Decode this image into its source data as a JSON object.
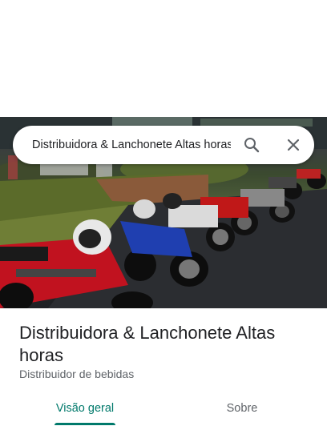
{
  "search": {
    "query": "Distribuidora & Lanchonete Altas horas"
  },
  "place": {
    "name": "Distribuidora & Lanchonete Altas horas",
    "category": "Distribuidor de bebidas"
  },
  "tabs": [
    {
      "label": "Visão geral",
      "active": true
    },
    {
      "label": "Sobre",
      "active": false
    }
  ],
  "icons": {
    "search": "search-icon",
    "close": "close-icon"
  },
  "colors": {
    "accent": "#00796b",
    "text_primary": "#202124",
    "text_secondary": "#5f6368"
  }
}
